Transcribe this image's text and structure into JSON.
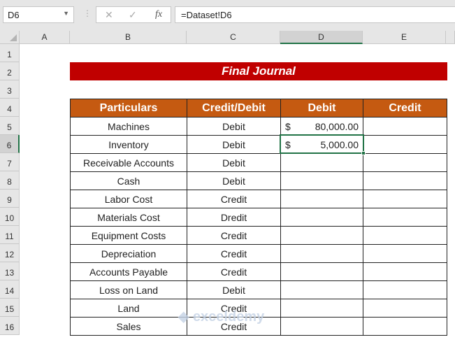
{
  "name_box": "D6",
  "formula": "=Dataset!D6",
  "formula_icons": [
    "cancel-icon",
    "enter-icon",
    "fx-icon"
  ],
  "fx_label": "fx",
  "columns": [
    "A",
    "B",
    "C",
    "D",
    "E"
  ],
  "rows": [
    "1",
    "2",
    "3",
    "4",
    "5",
    "6",
    "7",
    "8",
    "9",
    "10",
    "11",
    "12",
    "13",
    "14",
    "15",
    "16"
  ],
  "selected_cell": "D6",
  "title": "Final Journal",
  "table": {
    "headers": [
      "Particulars",
      "Credit/Debit",
      "Debit",
      "Credit"
    ],
    "rows": [
      {
        "particular": "Machines",
        "type": "Debit",
        "debit_symbol": "$",
        "debit": "80,000.00"
      },
      {
        "particular": "Inventory",
        "type": "Debit",
        "debit_symbol": "$",
        "debit": "5,000.00"
      },
      {
        "particular": "Receivable Accounts",
        "type": "Debit"
      },
      {
        "particular": "Cash",
        "type": "Debit"
      },
      {
        "particular": "Labor Cost",
        "type": "Credit"
      },
      {
        "particular": "Materials Cost",
        "type": "Dredit"
      },
      {
        "particular": "Equipment Costs",
        "type": "Credit"
      },
      {
        "particular": "Depreciation",
        "type": "Credit"
      },
      {
        "particular": "Accounts Payable",
        "type": "Credit"
      },
      {
        "particular": "Loss on Land",
        "type": "Debit"
      },
      {
        "particular": "Land",
        "type": "Credit"
      },
      {
        "particular": "Sales",
        "type": "Credit"
      }
    ]
  },
  "colors": {
    "title_bg": "#c00000",
    "header_bg": "#c55a11",
    "selection": "#217346"
  },
  "watermark": "exceldemy"
}
